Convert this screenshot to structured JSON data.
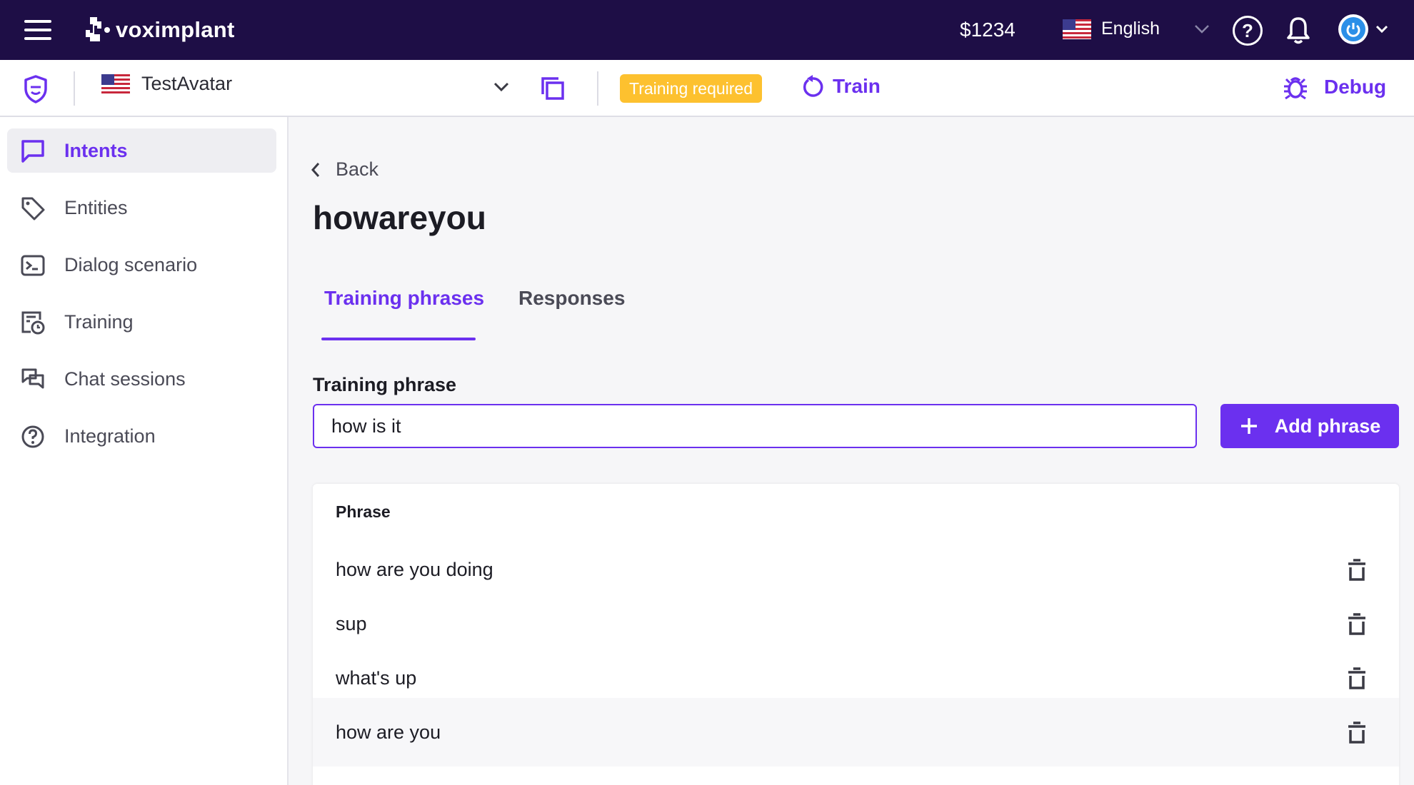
{
  "header": {
    "logo_text": "voximplant",
    "balance": "$1234",
    "language": "English"
  },
  "subbar": {
    "avatar_name": "TestAvatar",
    "badge": "Training required",
    "train_label": "Train",
    "debug_label": "Debug"
  },
  "sidebar": {
    "items": [
      {
        "label": "Intents",
        "icon": "chat-icon",
        "active": true
      },
      {
        "label": "Entities",
        "icon": "tag-icon"
      },
      {
        "label": "Dialog scenario",
        "icon": "terminal-icon"
      },
      {
        "label": "Training",
        "icon": "training-icon"
      },
      {
        "label": "Chat sessions",
        "icon": "chat-sessions-icon"
      },
      {
        "label": "Integration",
        "icon": "help-circle-icon"
      }
    ]
  },
  "main": {
    "back_label": "Back",
    "title": "howareyou",
    "tabs": [
      {
        "label": "Training phrases",
        "active": true
      },
      {
        "label": "Responses"
      }
    ],
    "field_label": "Training phrase",
    "input_value": "how is it",
    "add_button": "Add phrase",
    "table": {
      "header": "Phrase",
      "rows": [
        "how are you doing",
        "sup",
        "what's up",
        "how are you"
      ]
    }
  },
  "colors": {
    "accent": "#6b30ef",
    "topbar": "#1e0e46",
    "badge": "#fdc12f"
  }
}
